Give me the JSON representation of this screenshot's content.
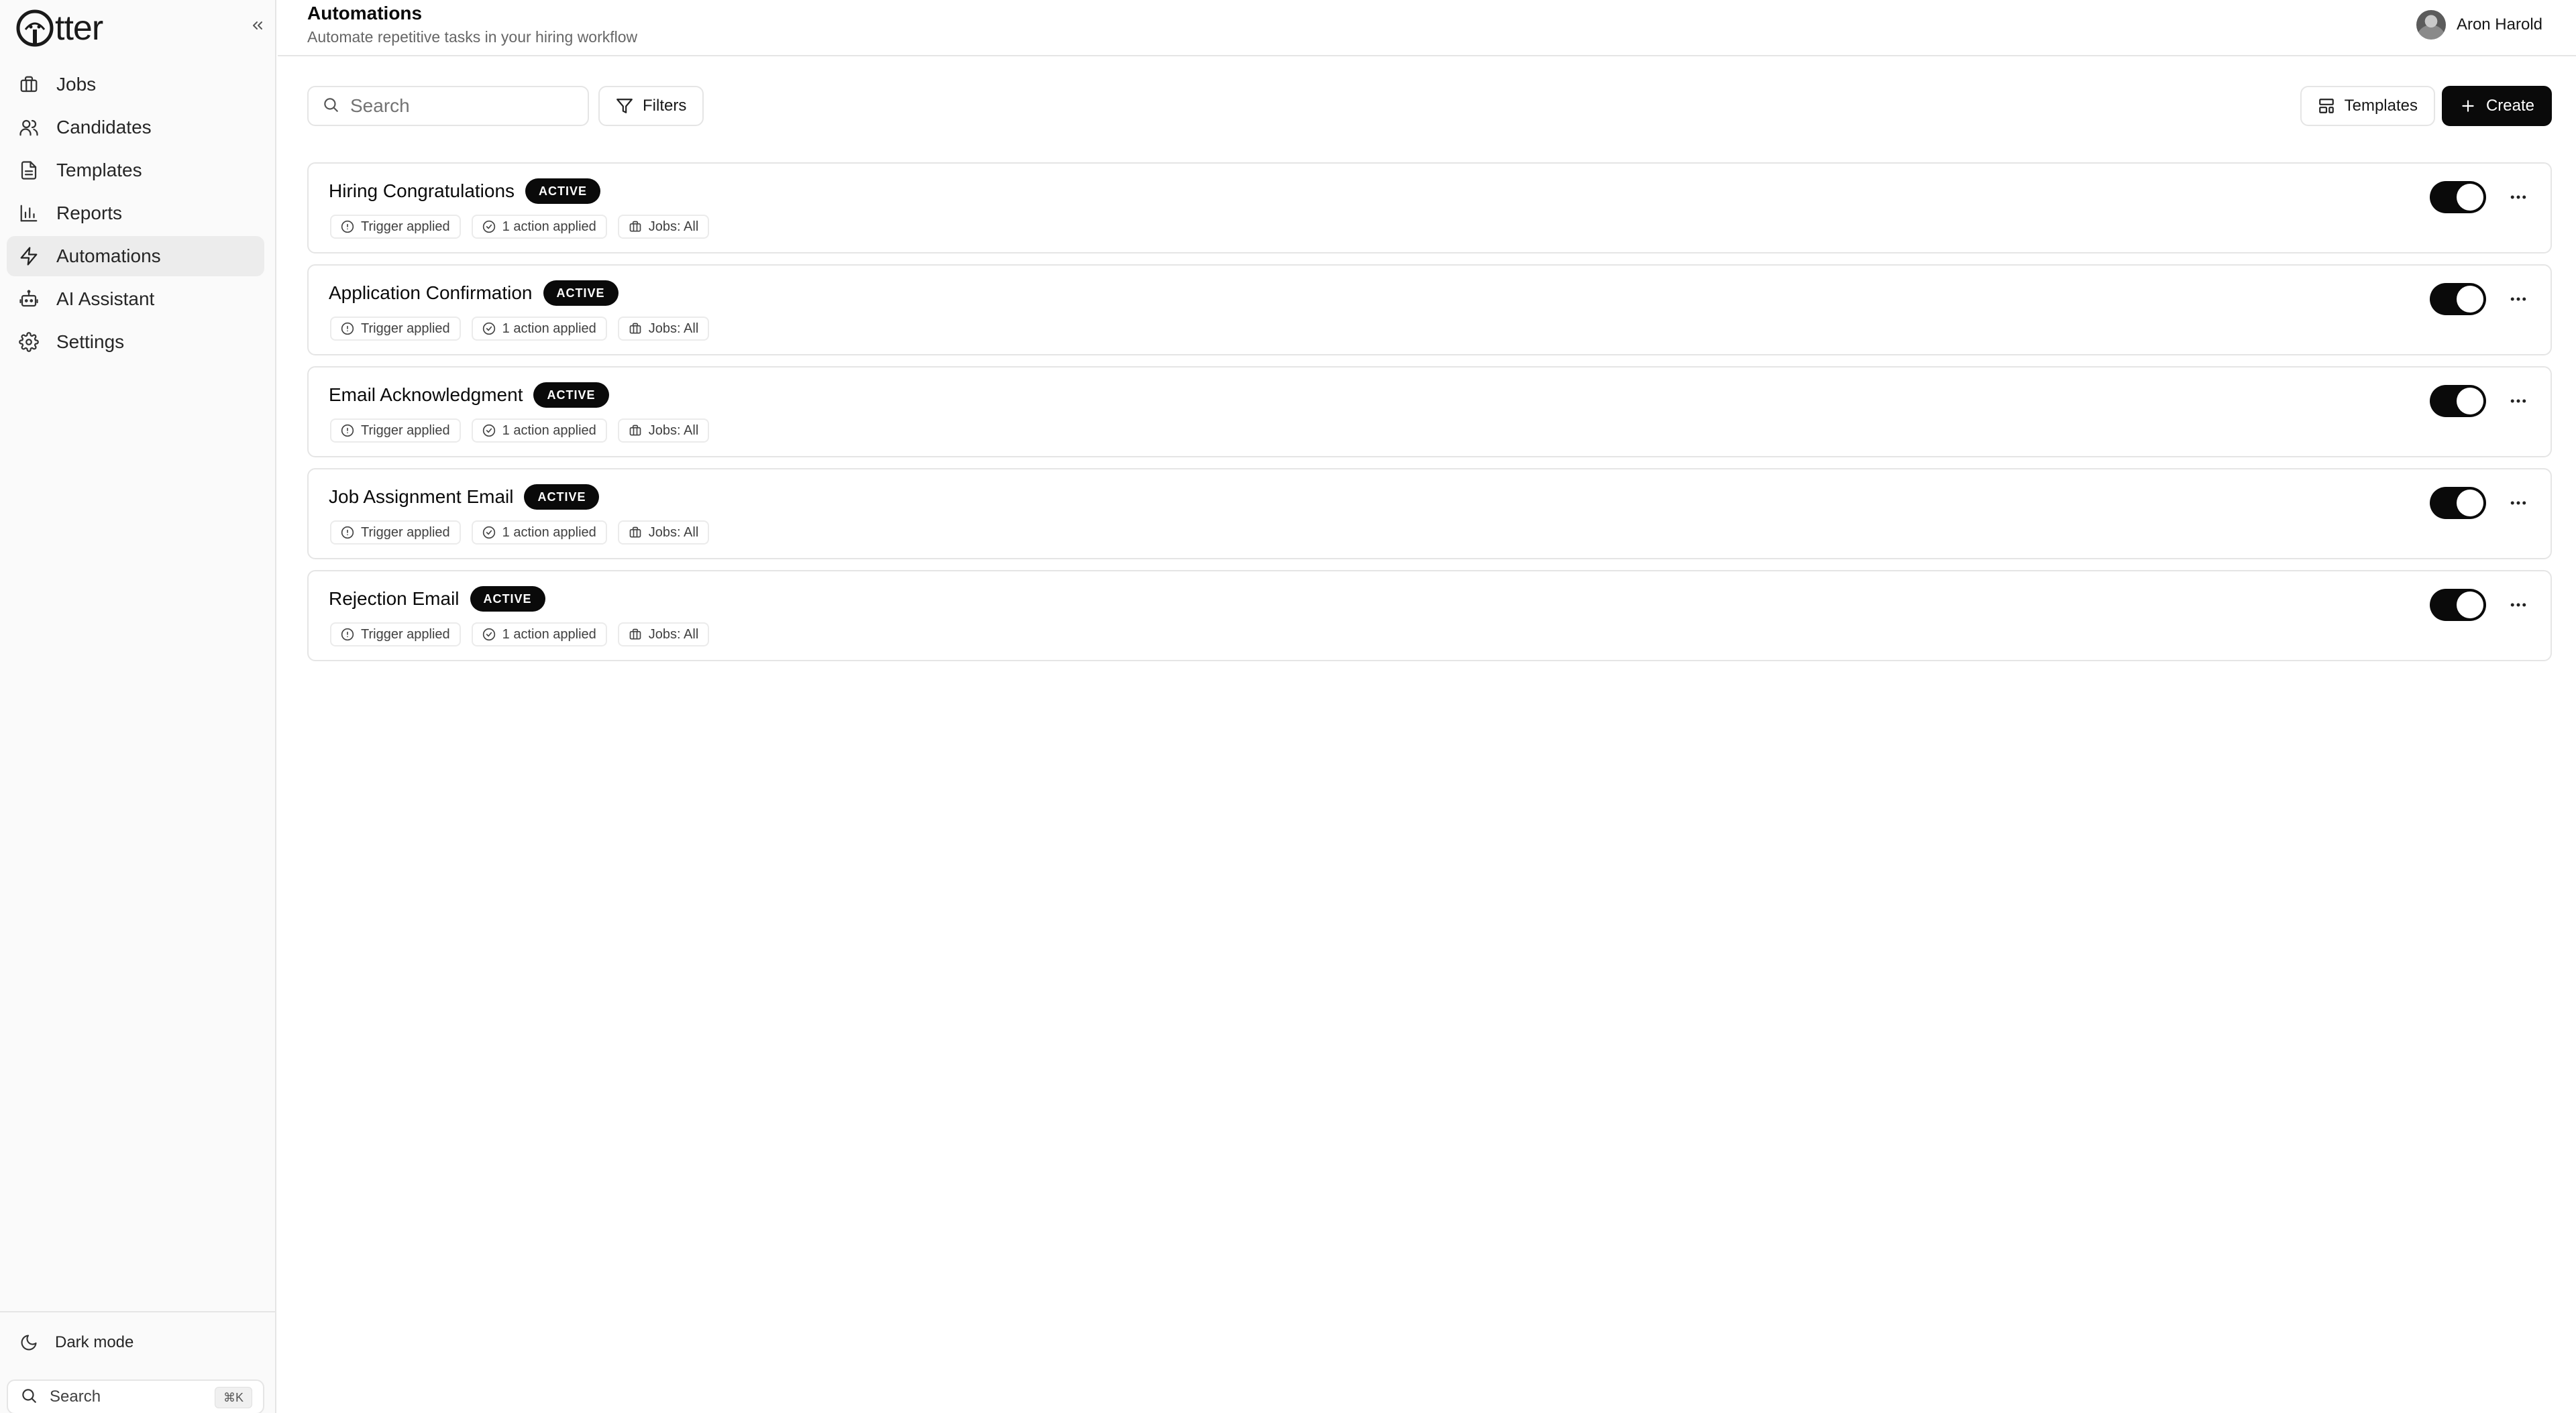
{
  "app": {
    "name": "tter"
  },
  "sidebar": {
    "items": [
      {
        "label": "Jobs",
        "icon": "briefcase-icon",
        "active": false
      },
      {
        "label": "Candidates",
        "icon": "users-icon",
        "active": false
      },
      {
        "label": "Templates",
        "icon": "file-text-icon",
        "active": false
      },
      {
        "label": "Reports",
        "icon": "bar-chart-icon",
        "active": false
      },
      {
        "label": "Automations",
        "icon": "zap-icon",
        "active": true
      },
      {
        "label": "AI Assistant",
        "icon": "bot-icon",
        "active": false
      },
      {
        "label": "Settings",
        "icon": "gear-icon",
        "active": false
      }
    ],
    "dark_mode_label": "Dark mode",
    "search_label": "Search",
    "search_shortcut": "⌘K"
  },
  "header": {
    "title": "Automations",
    "subtitle": "Automate repetitive tasks in your hiring workflow",
    "user_name": "Aron Harold"
  },
  "toolbar": {
    "search_placeholder": "Search",
    "filters_label": "Filters",
    "templates_label": "Templates",
    "create_label": "Create"
  },
  "automations": [
    {
      "title": "Hiring Congratulations",
      "status": "ACTIVE",
      "trigger": "Trigger applied",
      "actions": "1 action applied",
      "jobs": "Jobs: All",
      "enabled": true
    },
    {
      "title": "Application Confirmation",
      "status": "ACTIVE",
      "trigger": "Trigger applied",
      "actions": "1 action applied",
      "jobs": "Jobs: All",
      "enabled": true
    },
    {
      "title": "Email Acknowledgment",
      "status": "ACTIVE",
      "trigger": "Trigger applied",
      "actions": "1 action applied",
      "jobs": "Jobs: All",
      "enabled": true
    },
    {
      "title": "Job Assignment Email",
      "status": "ACTIVE",
      "trigger": "Trigger applied",
      "actions": "1 action applied",
      "jobs": "Jobs: All",
      "enabled": true
    },
    {
      "title": "Rejection Email",
      "status": "ACTIVE",
      "trigger": "Trigger applied",
      "actions": "1 action applied",
      "jobs": "Jobs: All",
      "enabled": true
    }
  ],
  "colors": {
    "accent": "#0a0a0a",
    "sidebar_bg": "#fafafa",
    "active_item_bg": "#ececec",
    "border": "#e5e5e5"
  }
}
